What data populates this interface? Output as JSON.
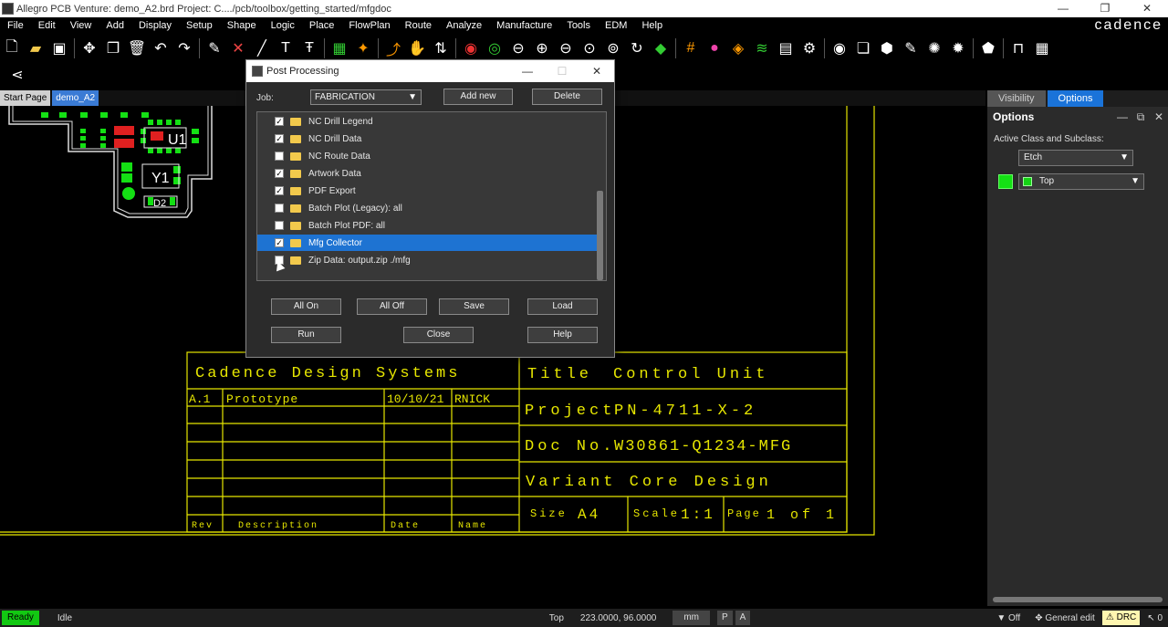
{
  "window": {
    "title": "Allegro PCB Venture: demo_A2.brd  Project: C..../pcb/toolbox/getting_started/mfgdoc",
    "minimize": "—",
    "maximize": "❐",
    "close": "✕"
  },
  "menubar": {
    "items": [
      "File",
      "Edit",
      "View",
      "Add",
      "Display",
      "Setup",
      "Shape",
      "Logic",
      "Place",
      "FlowPlan",
      "Route",
      "Analyze",
      "Manufacture",
      "Tools",
      "EDM",
      "Help"
    ],
    "brand": "cadence"
  },
  "toolbar": {
    "icons_row1": [
      "new-icon",
      "open-icon",
      "save-icon",
      "move-icon",
      "copy-icon",
      "delete-icon",
      "undo-icon",
      "redo-icon",
      "pin-icon",
      "unpin-icon",
      "add-line-icon",
      "text-icon",
      "edit-text-icon",
      "place-icon",
      "component-icon",
      "route-icon",
      "slide-icon",
      "spread-icon",
      "drc-icon",
      "ratsnest-icon",
      "zoom-fit-icon",
      "zoom-in-icon",
      "zoom-out-icon",
      "zoom-prev-icon",
      "zoom-window-icon",
      "redraw-icon",
      "3d-icon",
      "grid-icon",
      "color-icon",
      "shape-icon",
      "layers-icon",
      "settings-icon",
      "visibility-icon",
      "props-icon",
      "cube-icon",
      "shadow-icon",
      "light-icon",
      "highlight-icon",
      "padstack-icon",
      "bom-icon",
      "export-icon"
    ],
    "icons_row2": [
      "share-icon"
    ]
  },
  "tabs": {
    "start": "Start Page",
    "doc": "demo_A2"
  },
  "title_block": {
    "company": "Cadence Design Systems",
    "rev": "A.1",
    "rev_desc": "Prototype",
    "date": "10/10/21",
    "name": "RNICK",
    "title_label": "Title",
    "title_value": "Control Unit",
    "project_label": "Project",
    "project_value": "PN-4711-X-2",
    "doc_label": "Doc No.",
    "doc_value": "W30861-Q1234-MFG",
    "variant": "Variant Core Design",
    "size_label": "Size",
    "size_value": "A4",
    "scale_label": "Scale",
    "scale_value": "1:1",
    "page_label": "Page",
    "page_value": "1 of 1",
    "col_rev": "Rev",
    "col_desc": "Description",
    "col_date": "Date",
    "col_name": "Name"
  },
  "pcb": {
    "u1": "U1",
    "y1": "Y1",
    "d2": "D2"
  },
  "right_panel": {
    "tabs": [
      "Visibility",
      "Options"
    ],
    "header": "Options",
    "ctrls": [
      "—",
      "⧉",
      "✕"
    ],
    "label": "Active Class and Subclass:",
    "class": "Etch",
    "subclass": "Top",
    "subclass_color": "#14e014"
  },
  "dialog": {
    "title": "Post Processing",
    "minimize": "—",
    "maximize": "☐",
    "close": "✕",
    "job_label": "Job:",
    "job_value": "FABRICATION",
    "add_new": "Add new",
    "delete": "Delete",
    "items": [
      {
        "name": "NC Drill Legend",
        "checked": true
      },
      {
        "name": "NC Drill Data",
        "checked": true
      },
      {
        "name": "NC Route Data",
        "checked": false
      },
      {
        "name": "Artwork Data",
        "checked": true
      },
      {
        "name": "PDF Export",
        "checked": true
      },
      {
        "name": "Batch Plot (Legacy): all",
        "checked": false
      },
      {
        "name": "Batch Plot PDF: all",
        "checked": false
      },
      {
        "name": "Mfg Collector",
        "checked": true,
        "selected": true
      },
      {
        "name": "Zip Data: output.zip ./mfg",
        "checked": false
      }
    ],
    "all_on": "All On",
    "all_off": "All Off",
    "save": "Save",
    "load": "Load",
    "run": "Run",
    "close_btn": "Close",
    "help": "Help",
    "check_mark": "✓"
  },
  "statusbar": {
    "ready": "Ready",
    "idle": "Idle",
    "layer": "Top",
    "coords": "223.0000, 96.0000",
    "unit": "mm",
    "p": "P",
    "a": "A",
    "filter": "Off",
    "mode": "General edit",
    "drc": "DRC",
    "count": "0"
  },
  "colors": {
    "board_outline": "#e6e600",
    "selection": "#1e73d2",
    "accent": "#1a73d9",
    "ready": "#12c812"
  }
}
